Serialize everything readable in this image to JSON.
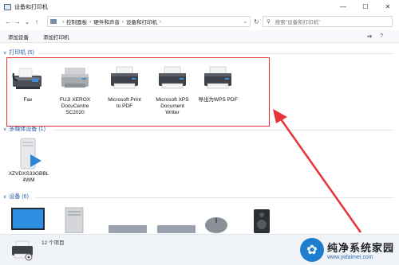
{
  "window": {
    "title": "设备和打印机",
    "controls": [
      "—",
      "☐",
      "✕"
    ]
  },
  "nav": {
    "back": "←",
    "forward": "→",
    "recent": "⌄",
    "up": "↑",
    "breadcrumb": [
      "控制面板",
      "硬件和声音",
      "设备和打印机"
    ],
    "refresh": "↻",
    "search_placeholder": "搜索\"设备和打印机\""
  },
  "commands": {
    "add_device": "添加设备",
    "add_printer": "添加打印机"
  },
  "groups": {
    "printers": {
      "header": "打印机 (5)",
      "items": [
        {
          "label": "Fax",
          "icon": "fax-icon"
        },
        {
          "label": "FUJI XEROX\nDocuCentre\nSC2020",
          "icon": "printer-icon"
        },
        {
          "label": "Microsoft Print\nto PDF",
          "icon": "printer-icon"
        },
        {
          "label": "Microsoft XPS\nDocument\nWriter",
          "icon": "printer-icon"
        },
        {
          "label": "导出为WPS PDF",
          "icon": "printer-icon"
        }
      ]
    },
    "multimedia": {
      "header": "多媒体设备 (1)",
      "items": [
        {
          "label": "XZVDXS33GBBL\n4WM",
          "icon": "media-server-icon"
        }
      ]
    },
    "devices": {
      "header": "设备 (6)"
    }
  },
  "status": {
    "count": "12 个项目"
  },
  "watermark": {
    "title": "纯净系统家园",
    "url": "www.yidaimei.com"
  },
  "colors": {
    "highlight": "#e8323a",
    "group_header": "#1e5aa8",
    "arrow": "#e8323a"
  }
}
